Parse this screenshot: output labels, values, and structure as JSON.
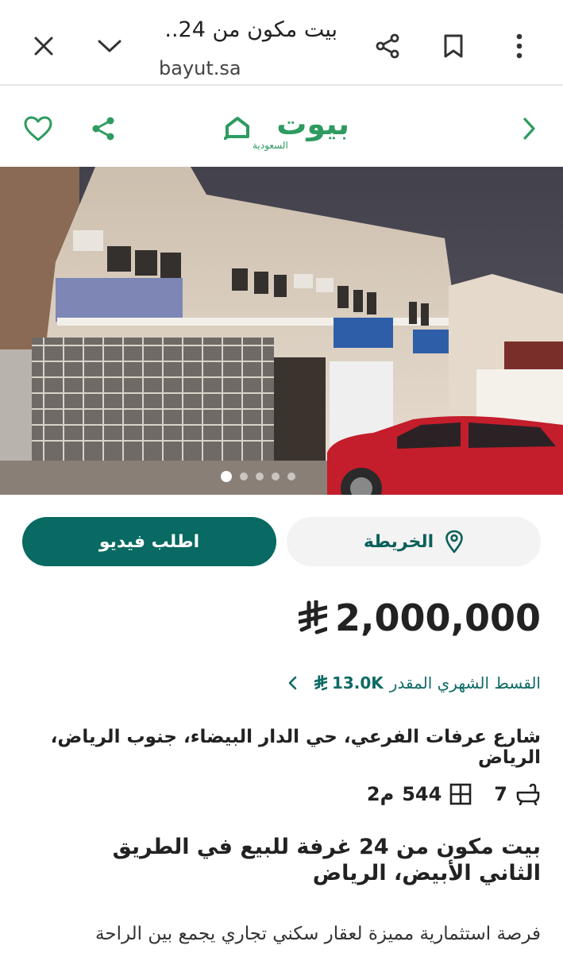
{
  "browser": {
    "title": "بيت مكون من 24...",
    "url": "bayut.sa",
    "icons": [
      "close-icon",
      "chevron-down-icon",
      "share-icon",
      "bookmark-icon",
      "more-vertical-icon"
    ]
  },
  "header": {
    "logo_main": "بيوت",
    "logo_sub": "السعودية",
    "icons": [
      "heart-icon",
      "share-icon",
      "chevron-right-icon"
    ],
    "accent": "#2e9b60"
  },
  "photo": {
    "slide_count": 5,
    "active_slide": 1
  },
  "actions": {
    "video_label": "اطلب فيديو",
    "map_label": "الخريطة",
    "primary_color": "#086a62"
  },
  "price": {
    "value": "2,000,000"
  },
  "monthly": {
    "label": "القسط الشهري المقدر",
    "value": "13.0K"
  },
  "address": "شارع عرفات الفرعي، حي الدار البيضاء، جنوب الرياض، الرياض",
  "specs": {
    "baths": "7",
    "area": "544",
    "area_unit": "م2"
  },
  "listing_title": "بيت مكون من 24 غرفة للبيع في الطريق الثاني الأبيض، الرياض",
  "description": "فرصة استثمارية مميزة لعقار سكني تجاري يجمع بين الراحة"
}
